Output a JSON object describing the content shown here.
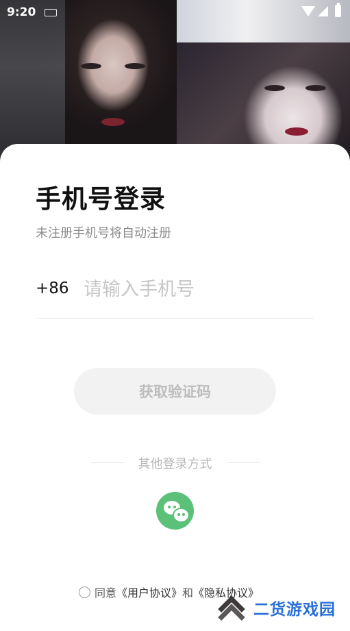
{
  "status_bar": {
    "time": "9:20"
  },
  "login": {
    "title": "手机号登录",
    "subtitle": "未注册手机号将自动注册",
    "country_code": "+86",
    "phone_placeholder": "请输入手机号",
    "phone_value": "",
    "get_code_label": "获取验证码",
    "other_methods_label": "其他登录方式"
  },
  "agreement": {
    "prefix": "同意",
    "user_agreement": "《用户协议》",
    "conjunction": "和",
    "privacy_policy": "《隐私协议》"
  },
  "watermark": {
    "text": "二货游戏园"
  },
  "colors": {
    "wechat_green": "#5bc078",
    "watermark_blue": "#2a6fd8"
  }
}
